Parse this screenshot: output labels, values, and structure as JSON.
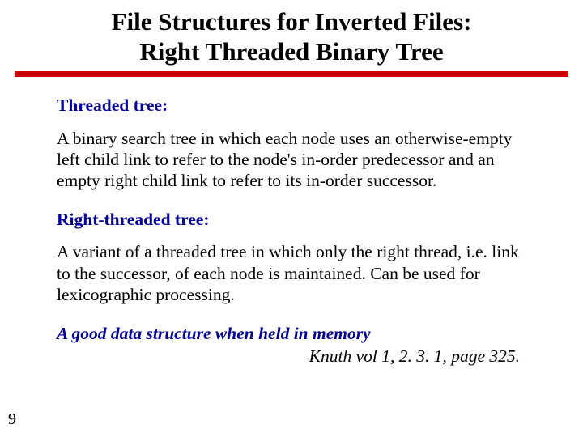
{
  "title_line1": "File Structures for Inverted Files:",
  "title_line2": "Right Threaded Binary Tree",
  "section1": {
    "heading": "Threaded tree:",
    "body": "A binary search tree in which each node uses an otherwise-empty left child link to refer to the node's in-order predecessor and an empty right child link to refer to its in-order successor."
  },
  "section2": {
    "heading": "Right-threaded tree:",
    "body": "A variant of a threaded tree in which only the right thread, i.e. link to the successor, of each node is maintained.  Can be used for lexicographic processing."
  },
  "footer_note": "A good data structure when held in memory",
  "citation": "Knuth vol 1, 2. 3. 1, page 325.",
  "page_number": "9"
}
